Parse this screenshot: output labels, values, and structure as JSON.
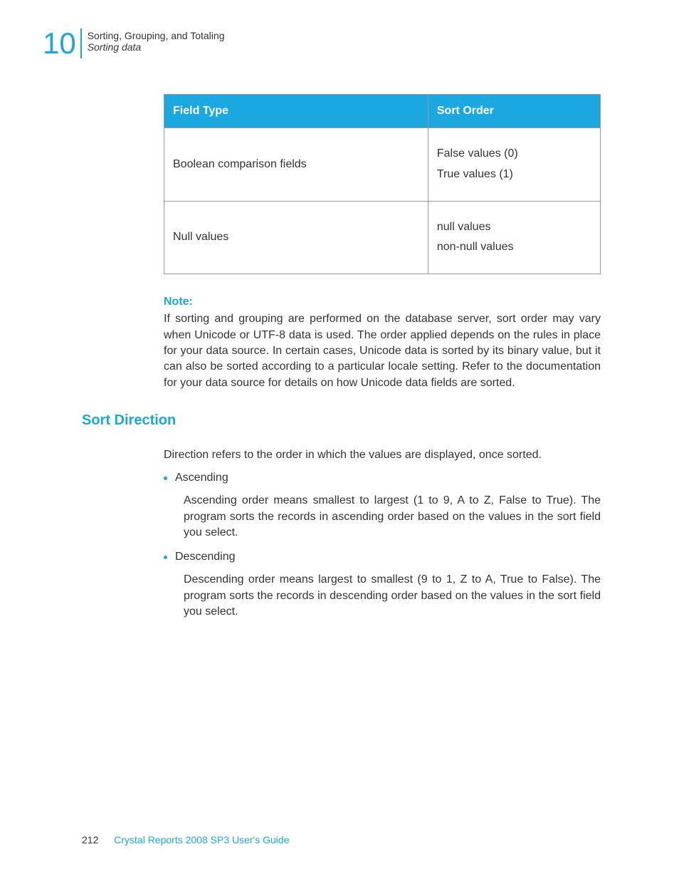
{
  "header": {
    "chapter_number": "10",
    "chapter_title": "Sorting, Grouping, and Totaling",
    "chapter_subtitle": "Sorting data"
  },
  "table": {
    "headers": {
      "col1": "Field Type",
      "col2": "Sort Order"
    },
    "rows": [
      {
        "field_type": "Boolean comparison fields",
        "sort_order_line1": "False values (0)",
        "sort_order_line2": "True values (1)"
      },
      {
        "field_type": "Null values",
        "sort_order_line1": "null values",
        "sort_order_line2": "non-null values"
      }
    ]
  },
  "note": {
    "label": "Note:",
    "text": "If sorting and grouping are performed on the database server, sort order may vary when Unicode or UTF-8 data is used. The order applied depends on the rules in place for your data source. In certain cases, Unicode data is sorted by its binary value, but it can also be sorted according to a particular locale setting. Refer to the documentation for your data source for details on how Unicode data fields are sorted."
  },
  "section": {
    "heading": "Sort Direction",
    "intro": "Direction refers to the order in which the values are displayed, once sorted.",
    "items": [
      {
        "label": "Ascending",
        "desc": "Ascending order means smallest to largest (1 to 9, A to Z, False to True). The program sorts the records in ascending order based on the values in the sort field you select."
      },
      {
        "label": "Descending",
        "desc": "Descending order means largest to smallest (9 to 1, Z to A, True to False). The program sorts the records in descending order based on the values in the sort field you select."
      }
    ]
  },
  "footer": {
    "page_number": "212",
    "doc_title": "Crystal Reports 2008 SP3 User's Guide"
  }
}
